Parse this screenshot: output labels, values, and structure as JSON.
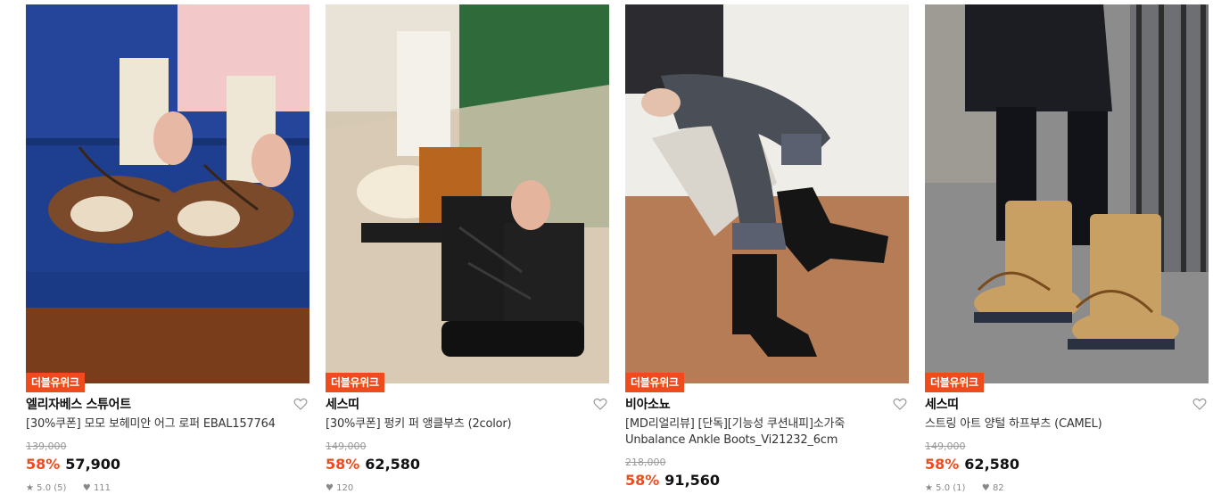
{
  "products": [
    {
      "badge": "더블유위크",
      "brand": "엘리자베스 스튜어트",
      "name_line1": "[30%쿠폰] 모모 보헤미안 어그 로퍼 EBAL157764",
      "name_line2": "",
      "original_price": "139,000",
      "discount": "58%",
      "price": "57,900",
      "rating": "5.0 (5)",
      "likes": "111"
    },
    {
      "badge": "더블유위크",
      "brand": "세스띠",
      "name_line1": "[30%쿠폰] 펑키 퍼 앵클부츠 (2color)",
      "name_line2": "",
      "original_price": "149,000",
      "discount": "58%",
      "price": "62,580",
      "rating": "",
      "likes": "120"
    },
    {
      "badge": "더블유위크",
      "brand": "비아소뇨",
      "name_line1": "[MD리얼리뷰] [단독][기능성 쿠션내피]소가죽",
      "name_line2": "Unbalance Ankle Boots_Vi21232_6cm",
      "original_price": "218,000",
      "discount": "58%",
      "price": "91,560",
      "rating": "",
      "likes": ""
    },
    {
      "badge": "더블유위크",
      "brand": "세스띠",
      "name_line1": "스트링 아트 양털 하프부츠 (CAMEL)",
      "name_line2": "",
      "original_price": "149,000",
      "discount": "58%",
      "price": "62,580",
      "rating": "5.0 (1)",
      "likes": "82"
    }
  ],
  "icons": {
    "wishlist": "heart-outline-icon",
    "rating": "star-icon",
    "likes": "heart-filled-icon"
  },
  "colors": {
    "accent": "#f04b1d",
    "muted": "#999999"
  }
}
